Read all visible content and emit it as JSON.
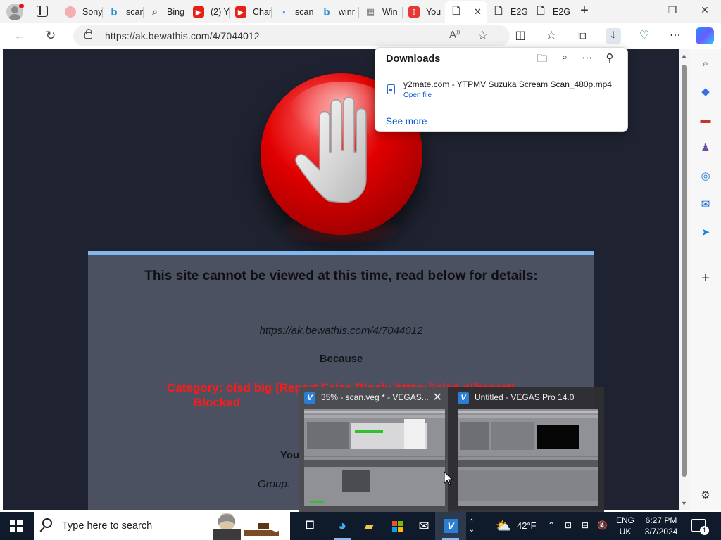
{
  "browser": {
    "tabs": [
      {
        "label": "Sony",
        "icon": "sony-favicon",
        "color": "#f08a8a"
      },
      {
        "label": "scan",
        "icon": "bing-favicon",
        "color": "#2a8fd1"
      },
      {
        "label": "Bing",
        "icon": "search-favicon",
        "color": "#555555"
      },
      {
        "label": "(2) Y",
        "icon": "youtube-favicon",
        "color": "#e62117"
      },
      {
        "label": "Char",
        "icon": "youtube-favicon",
        "color": "#e62117"
      },
      {
        "label": "scan",
        "icon": "edge-favicon",
        "color": "#3a8ee6"
      },
      {
        "label": "winr",
        "icon": "bing-favicon",
        "color": "#2a8fd1"
      },
      {
        "label": "Win",
        "icon": "grid-favicon",
        "color": "#8a8a8a"
      },
      {
        "label": "You",
        "icon": "download-favicon",
        "color": "#e53935"
      },
      {
        "label": "",
        "icon": "page-favicon",
        "color": "#333333",
        "active": true
      },
      {
        "label": "E2G",
        "icon": "page-favicon",
        "color": "#333333"
      },
      {
        "label": "E2G",
        "icon": "page-favicon",
        "color": "#333333"
      }
    ],
    "new_tab": "+",
    "address": "https://ak.bewathis.com/4/7044012"
  },
  "downloads": {
    "title": "Downloads",
    "file_name": "y2mate.com - YTPMV Suzuka Scream Scan_480p.mp4",
    "open_file": "Open file",
    "see_more": "See more"
  },
  "blocked_page": {
    "title": "This site cannot be viewed at this time, read below for details:",
    "url": "https://ak.bewathis.com/4/7044012",
    "because": "Because",
    "category": "Category: oisd big (Report False Block: https://oisd.nl/report)",
    "blocked": "Blocked",
    "you_prefix": "You",
    "group_prefix": "Group:"
  },
  "thumbnails": [
    {
      "title": "35% - scan.veg * - VEGAS...",
      "close": "✕",
      "app": "V"
    },
    {
      "title": "Untitled - VEGAS Pro 14.0",
      "app": "V"
    }
  ],
  "taskbar": {
    "search_placeholder": "Type here to search",
    "weather_temp": "42°F",
    "language": "ENG",
    "region": "UK",
    "time": "6:27 PM",
    "date": "3/7/2024",
    "notification_count": "1"
  }
}
